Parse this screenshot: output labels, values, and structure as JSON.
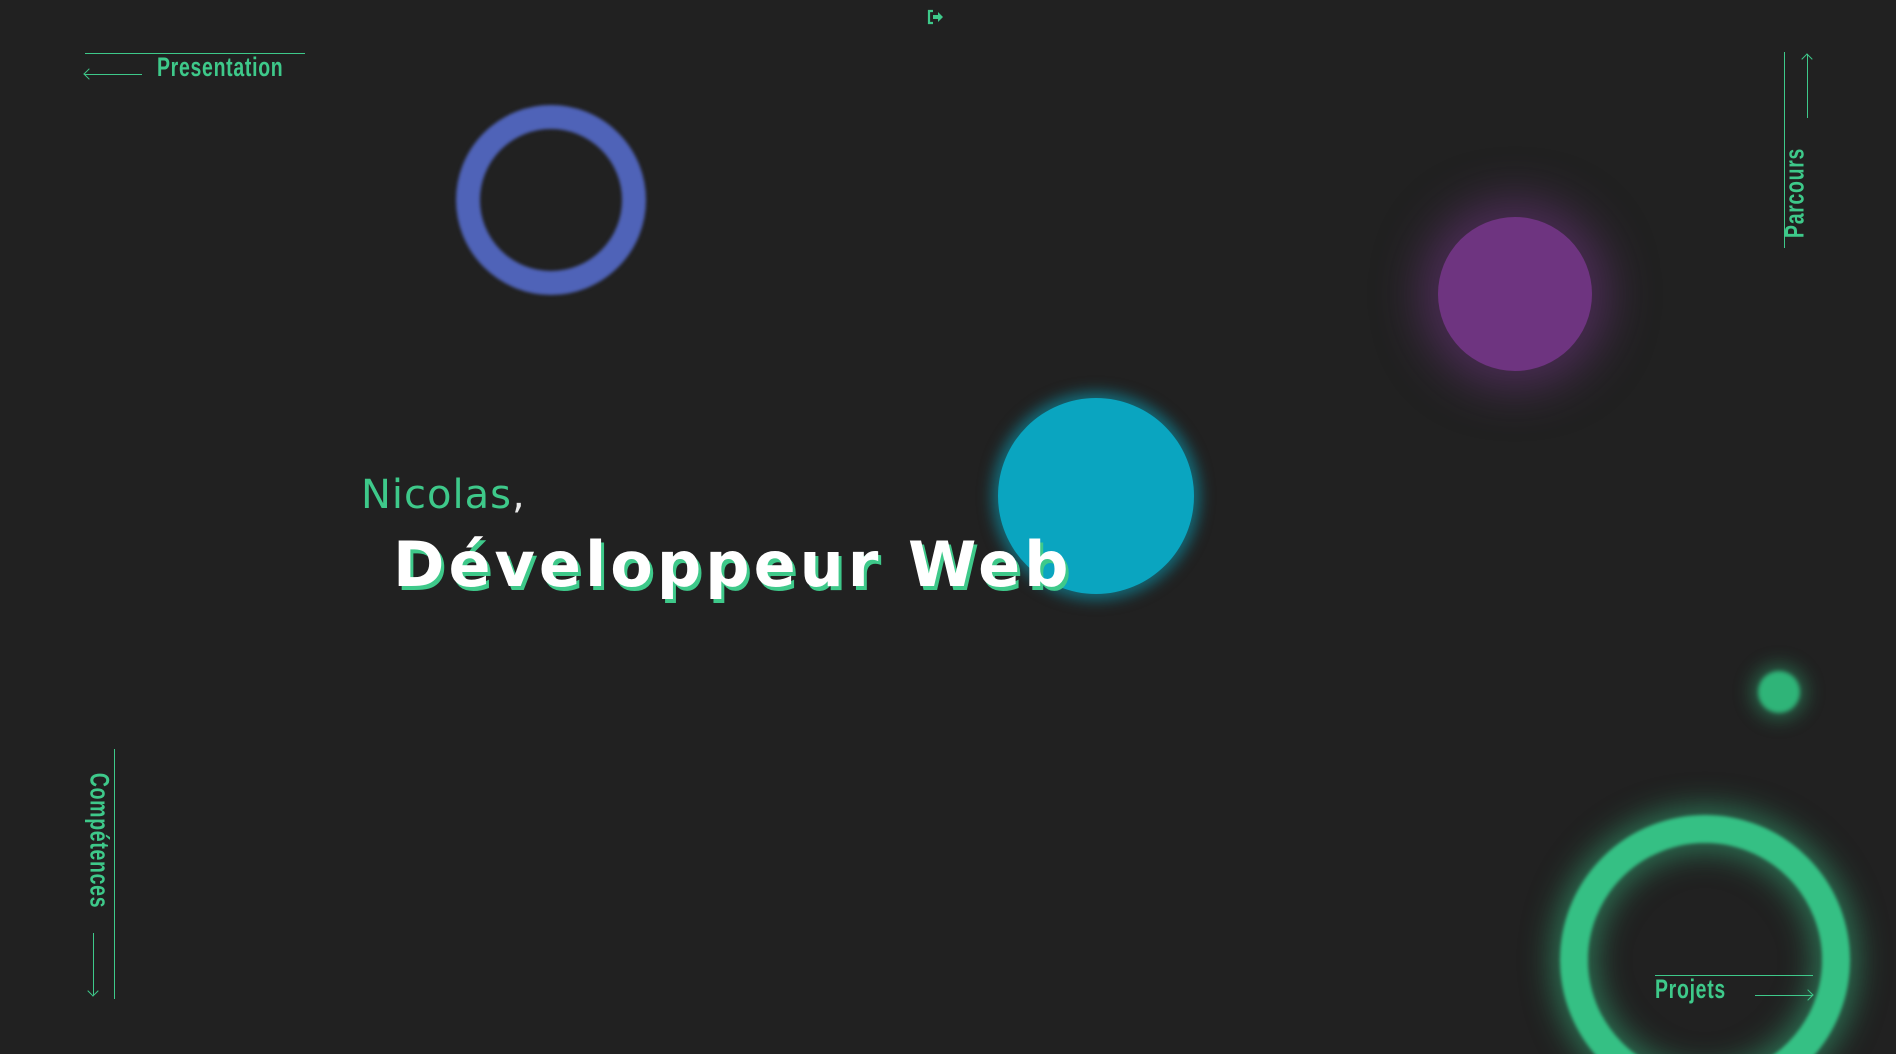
{
  "colors": {
    "background": "#212121",
    "accent": "#3ec98a",
    "ring_blue": "#4f63b8",
    "disc_purple": "#6e3480",
    "disc_cyan": "#0aa5c0",
    "ring_green": "#35c084",
    "title": "#ffffff"
  },
  "header": {
    "logout_icon": "sign-out-icon"
  },
  "nav": {
    "presentation": "Presentation",
    "parcours": "Parcours",
    "competences": "Compétences",
    "projets": "Projets"
  },
  "hero": {
    "name": "Nicolas",
    "name_suffix": ",",
    "title": "Développeur Web"
  }
}
